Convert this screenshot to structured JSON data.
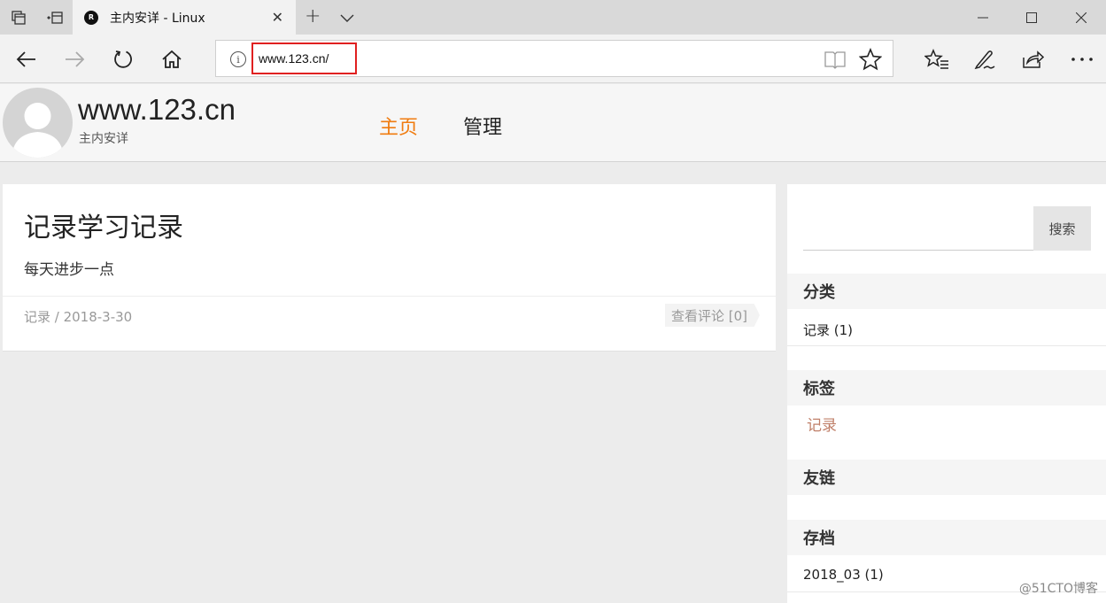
{
  "browser": {
    "tab_title": "主内安详 - Linux",
    "favicon_letter": "R",
    "address": "www.123.cn/"
  },
  "site": {
    "name": "www.123.cn",
    "subtitle": "主内安详",
    "nav": {
      "home": "主页",
      "admin": "管理"
    }
  },
  "post": {
    "title": "记录学习记录",
    "summary": "每天进步一点",
    "meta": "记录 / 2018-3-30",
    "comments": "查看评论 [0]"
  },
  "sidebar": {
    "search_button": "搜索",
    "categories": {
      "heading": "分类",
      "items": [
        "记录 (1)"
      ]
    },
    "tags": {
      "heading": "标签",
      "items": [
        "记录"
      ]
    },
    "links": {
      "heading": "友链"
    },
    "archive": {
      "heading": "存档",
      "items": [
        "2018_03 (1)"
      ]
    }
  },
  "watermark": "@51CTO博客",
  "colors": {
    "nav_active": "#f07c10",
    "url_highlight": "#e02020",
    "tag_link": "#c0806a"
  }
}
